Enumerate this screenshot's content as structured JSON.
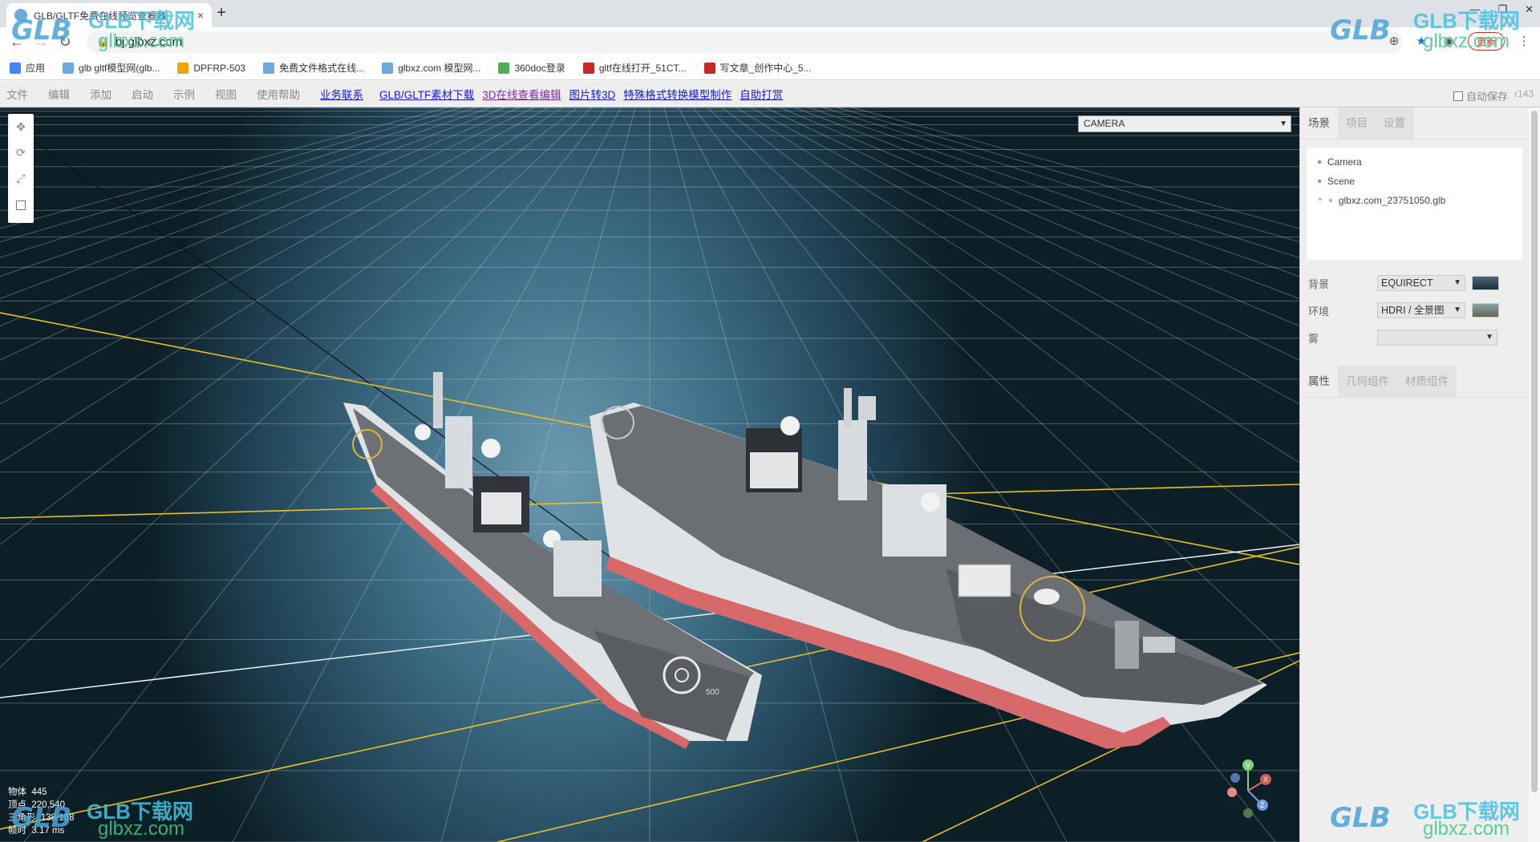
{
  "browser": {
    "tab_title": "GLB/GLTF免费在线预览查看器",
    "new_tab": "+",
    "tab_close": "×",
    "url": "bj.glbxz.com",
    "update_button": "更新",
    "window_controls": [
      "—",
      "❐",
      "✕"
    ],
    "bookmarks": [
      {
        "label": "应用",
        "color": "#4285f4"
      },
      {
        "label": "glb gltf模型网(glb...",
        "color": "#6fa8dc"
      },
      {
        "label": "DPFRP-503",
        "color": "#f0a30a"
      },
      {
        "label": "免费文件格式在线...",
        "color": "#6fa8dc"
      },
      {
        "label": "glbxz.com 模型网...",
        "color": "#6fa8dc"
      },
      {
        "label": "360doc登录",
        "color": "#4caf50"
      },
      {
        "label": "gltf在线打开_51CT...",
        "color": "#c62828"
      },
      {
        "label": "写文章_创作中心_5...",
        "color": "#c62828"
      }
    ]
  },
  "menubar": {
    "menus": [
      "文件",
      "编辑",
      "添加",
      "启动",
      "示例",
      "视图",
      "使用帮助"
    ],
    "links": [
      "业务联系",
      "GLB/GLTF素材下载",
      "3D在线查看编辑",
      "图片转3D",
      "特殊格式转换模型制作",
      "自助打赏"
    ],
    "autosave_label": "自动保存",
    "revision": "r143"
  },
  "viewport": {
    "camera_select": "CAMERA",
    "info": [
      {
        "label": "物体",
        "value": "445"
      },
      {
        "label": "顶点",
        "value": "220,540"
      },
      {
        "label": "三角形",
        "value": "138,198"
      },
      {
        "label": "帧时",
        "value": "3.17 ms"
      }
    ],
    "axis_labels": {
      "x": "X",
      "y": "Y",
      "z": "Z"
    },
    "hull_number": "500"
  },
  "sidebar": {
    "top_tabs": [
      "场景",
      "项目",
      "设置"
    ],
    "outliner": [
      {
        "label": "Camera",
        "dot": "#d66"
      },
      {
        "label": "Scene",
        "dot": "#88a"
      },
      {
        "label": "glbxz.com_23751050.glb",
        "dot": "#aac"
      }
    ],
    "properties": [
      {
        "label": "背景",
        "value": "EQUIRECT",
        "swatch": "#2e4656"
      },
      {
        "label": "环境",
        "value": "HDRI / 全景图",
        "swatch": "#6b7a66"
      },
      {
        "label": "雾",
        "value": ""
      }
    ],
    "bottom_tabs": [
      "属性",
      "几何组件",
      "材质组件"
    ]
  },
  "watermark": {
    "logo": "GLB",
    "brand": "GLB下载网",
    "url": "glbxz.com"
  }
}
